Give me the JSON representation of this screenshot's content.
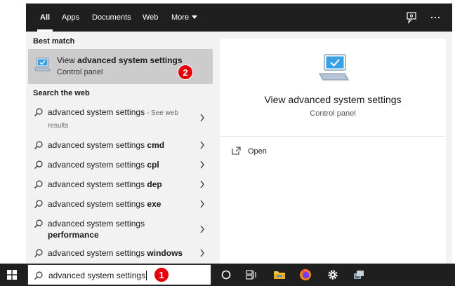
{
  "tabs": [
    {
      "label": "All",
      "active": true
    },
    {
      "label": "Apps",
      "active": false
    },
    {
      "label": "Documents",
      "active": false
    },
    {
      "label": "Web",
      "active": false
    },
    {
      "label": "More",
      "active": false
    }
  ],
  "top_icons": {
    "feedback": "feedback-icon",
    "more": "more-options-icon"
  },
  "results": {
    "best_match_header": "Best match",
    "best_match": {
      "title_prefix": "View ",
      "title_bold": "advanced system settings",
      "subtitle": "Control panel",
      "icon": "monitor-check-icon"
    },
    "web_header": "Search the web",
    "web_items": [
      {
        "query": "advanced system settings",
        "suffix": "",
        "muted": " - See web results"
      },
      {
        "query": "advanced system settings ",
        "suffix": "cmd",
        "muted": ""
      },
      {
        "query": "advanced system settings ",
        "suffix": "cpl",
        "muted": ""
      },
      {
        "query": "advanced system settings ",
        "suffix": "dep",
        "muted": ""
      },
      {
        "query": "advanced system settings ",
        "suffix": "exe",
        "muted": ""
      },
      {
        "query": "advanced system settings",
        "suffix": "performance",
        "muted": ""
      },
      {
        "query": "advanced system settings ",
        "suffix": "windows",
        "muted": ""
      }
    ]
  },
  "preview": {
    "title": "View advanced system settings",
    "subtitle": "Control panel",
    "actions": [
      {
        "label": "Open",
        "icon": "open-icon"
      }
    ]
  },
  "taskbar": {
    "search_value": "advanced system settings",
    "icons": [
      "windows-start-icon",
      "cortana-icon",
      "task-view-icon",
      "file-explorer-icon",
      "firefox-icon",
      "settings-gear-icon",
      "system-icon"
    ]
  },
  "badges": {
    "search_step": "1",
    "result_step": "2"
  },
  "colors": {
    "badge": "#e5000a",
    "tabbar": "#1f1f1f",
    "accent": "#1e90ff"
  }
}
